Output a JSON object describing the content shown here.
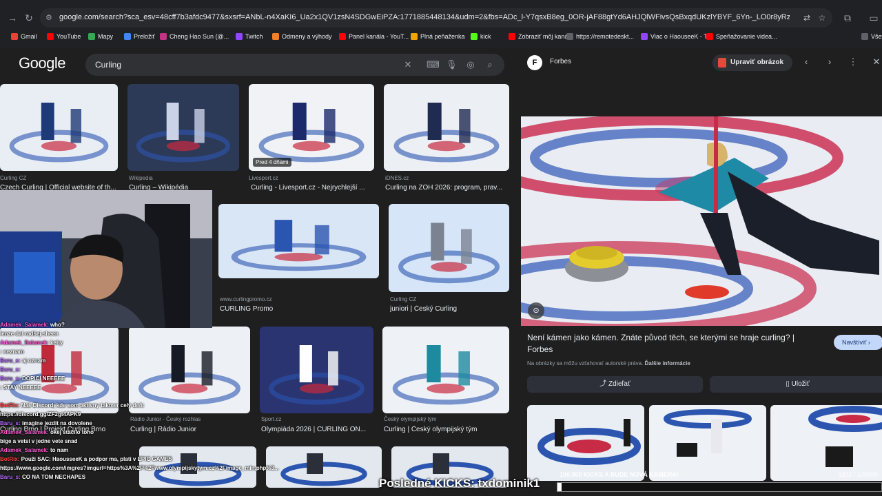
{
  "browser": {
    "url": "google.com/search?sca_esv=48cff7b3afdc9477&sxsrf=ANbL-n4XaKI6_Ua2x1QV1zsN4SDGwEiPZA:1771885448134&udm=2&fbs=ADc_l-Y7qsxB8eg_0OR-jAF88gtYd6AHJQlWFivsQsBxqdUKzlYBYF_6Yn-_LO0r8yRzNhRsDabRXkqdDmmTgkcD3zGZA...",
    "bookmarks": [
      {
        "label": "Gmail",
        "color": "#ea4335"
      },
      {
        "label": "YouTube",
        "color": "#ff0000"
      },
      {
        "label": "Mapy",
        "color": "#34a853"
      },
      {
        "label": "Preložiť",
        "color": "#4285f4"
      },
      {
        "label": "Cheng Hao Sun (@...",
        "color": "#c13584"
      },
      {
        "label": "Twitch",
        "color": "#9146ff"
      },
      {
        "label": "Odmeny a výhody",
        "color": "#f48024"
      },
      {
        "label": "Panel kanála - YouT...",
        "color": "#ff0000"
      },
      {
        "label": "Plná peňaženka",
        "color": "#f4a300"
      },
      {
        "label": "kick",
        "color": "#53fc18"
      },
      {
        "label": "Zobraziť môj kanál",
        "color": "#ff0000"
      },
      {
        "label": "https://remotedeskt...",
        "color": "#5f6368"
      },
      {
        "label": "Viac o HaouseeK - T...",
        "color": "#9146ff"
      },
      {
        "label": "Speňažovanie videa...",
        "color": "#ff0000"
      },
      {
        "label": "Všet",
        "color": "#5f6368"
      }
    ]
  },
  "google": {
    "logo": "Google",
    "query": "Curling"
  },
  "results": [
    {
      "source": "Curling CZ",
      "caption": "Czech Curling | Official website of th..."
    },
    {
      "source": "Wikipedia",
      "caption": "Curling – Wikipédia"
    },
    {
      "source": "Livesport.cz",
      "caption": "Curling - Livesport.cz - Nejrychlejší ...",
      "badge": "Pred 4 dňami"
    },
    {
      "source": "iDNES.cz",
      "caption": "Curling na ZOH 2026: program, prav..."
    },
    {
      "source": "www.curlingpromo.cz",
      "caption": "CURLING Promo"
    },
    {
      "source": "Curling CZ",
      "caption": "juniori | Český Curling"
    },
    {
      "source": "",
      "caption": "Curling Brno | Projekt Curling Brno"
    },
    {
      "source": "Rádio Junior - Český rozhlas",
      "caption": "Curling | Rádio Junior"
    },
    {
      "source": "Sport.cz",
      "caption": "Olympiáda 2026 | CURLING ON..."
    },
    {
      "source": "Český olympijský tým",
      "caption": "Curling | Český olympijský tým"
    }
  ],
  "panel": {
    "favicon": "F",
    "publisher": "Forbes",
    "edit_label": "Upraviť obrázok",
    "title": "Není kámen jako kámen. Znáte původ těch, se kterými se hraje curling? | Forbes",
    "visit_label": "Navštíviť",
    "rights_text": "Na obrázky sa môžu vzťahovať autorské práva.",
    "rights_link": "Ďalšie informácie",
    "share_label": "Zdieľať",
    "save_label": "Uložiť"
  },
  "stream": {
    "chat": [
      {
        "user": "Adamek_Salamek:",
        "msg": " who?",
        "color": "#ff5ad6"
      },
      {
        "user": "",
        "msg": "lenze dal radšej sheen",
        "color": "#ff5ad6"
      },
      {
        "user": "Adamek_Salamek:",
        "msg": " keby",
        "color": "#ff5ad6"
      },
      {
        "user": "",
        "msg": ": neznam",
        "color": "#b56cff"
      },
      {
        "user": "Baru_s:",
        "msg": " aj oznam",
        "color": "#b56cff"
      },
      {
        "user": "Baru_s:",
        "msg": " ",
        "color": "#b56cff"
      },
      {
        "user": "Baru_s:",
        "msg": " DOPICI NEEEEE",
        "color": "#b56cff"
      },
      {
        "user": "",
        "msg": ": STAY NEEEEE",
        "color": "#b56cff"
      },
      {
        "user": "",
        "msg": "",
        "color": "#b56cff"
      },
      {
        "user": "BotRix:",
        "msg": " Náš Discord, kde som aktívny takmer celý deň:",
        "color": "#ff4444"
      },
      {
        "user": "",
        "msg": "https://discord.gg/ZF2gt4APK9",
        "color": "#ffffff"
      },
      {
        "user": "Baru_s:",
        "msg": " imagine jezdit na dovolene",
        "color": "#b56cff"
      },
      {
        "user": "Adamek_Salamek:",
        "msg": " okej stačilo toho",
        "color": "#ff5ad6"
      },
      {
        "user": "",
        "msg": "bige a vetsi v jedne vete snad",
        "color": "#b56cff"
      },
      {
        "user": "Adamek_Salamek:",
        "msg": " to nam",
        "color": "#ff5ad6"
      },
      {
        "user": "BotRix:",
        "msg": " Použi SAC: HaousseeK a podpor ma, plati v EPIC GAMES",
        "color": "#ff4444"
      },
      {
        "user": "",
        "msg": "https://www.google.com/imgres?imgurl=https%3A%2F%2Fwww.olympijskytym.cz%2Fimage_min.php%3...",
        "color": "#ffffff"
      },
      {
        "user": "Baru_s:",
        "msg": " CO NA TOM NECHAPES",
        "color": "#b56cff"
      }
    ],
    "kicks_text": "Posledné KICKS: txdominik1",
    "goal_label": "100.000 KICKS A BUDE NOVÁ KAMERA!",
    "goal_count": "1202 / 100000",
    "goal_progress": 0.012
  },
  "colors": {
    "page_bg": "#1f1f1f",
    "chrome_bg": "#202124",
    "search_bg": "#303134",
    "visit_bg": "#c2d7fa",
    "edit_icon": "#e24b3b"
  }
}
